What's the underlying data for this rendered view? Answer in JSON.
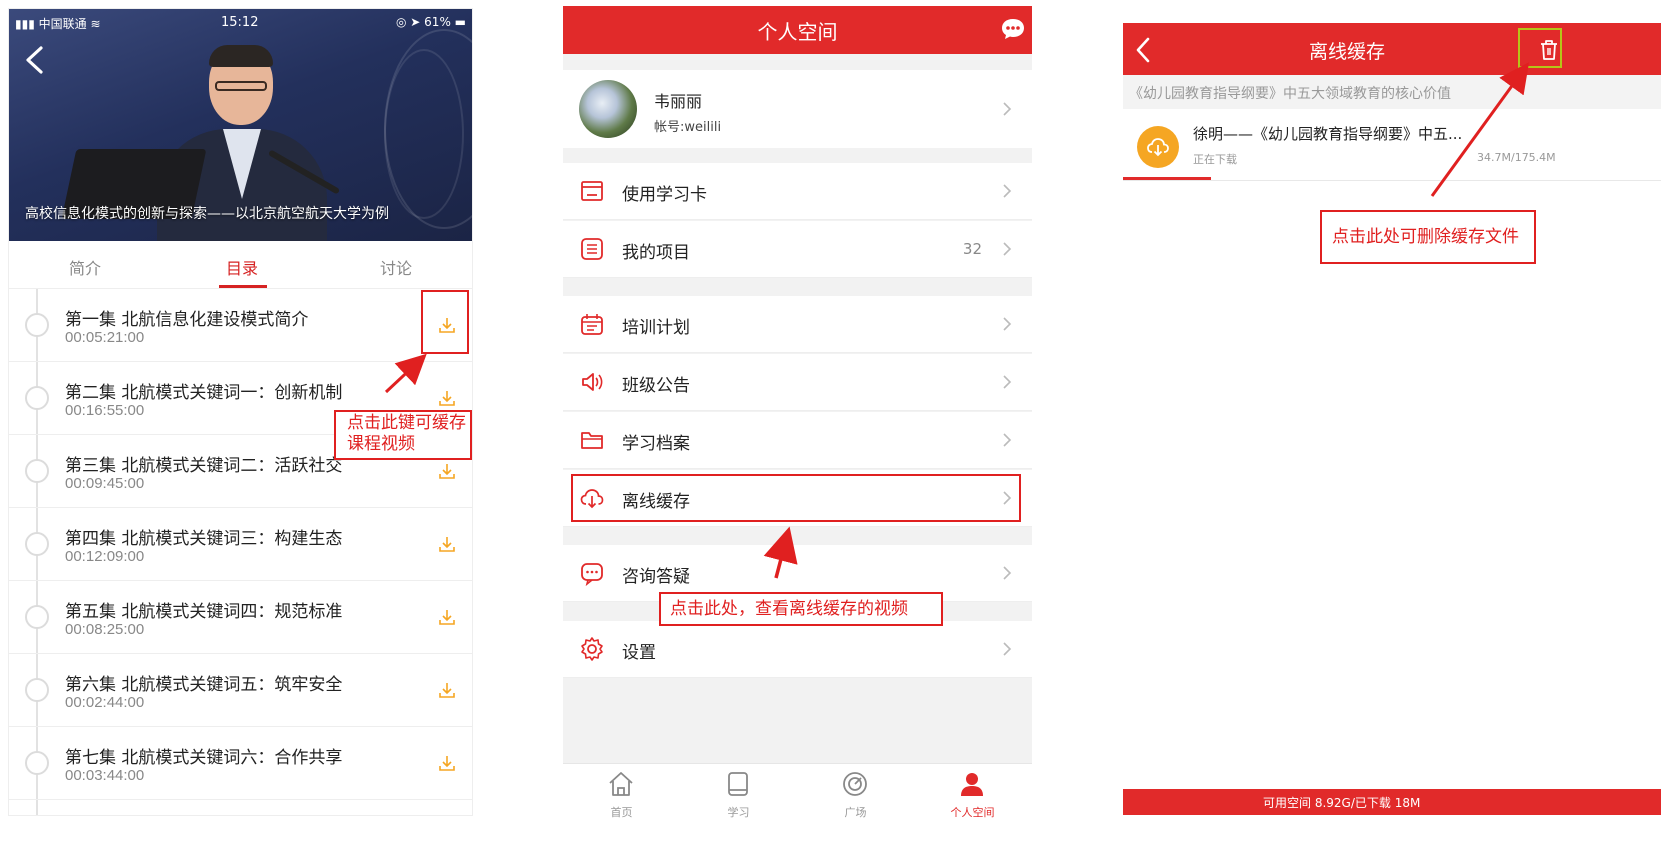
{
  "panel1": {
    "status": {
      "carrier": "中国联通",
      "time": "15:12",
      "battery": "61%"
    },
    "video_caption": "高校信息化模式的创新与探索——以北京航空航天大学为例",
    "tabs": [
      "简介",
      "目录",
      "讨论"
    ],
    "active_tab": "目录",
    "episodes": [
      {
        "title": "第一集 北航信息化建设模式简介",
        "duration": "00:05:21:00"
      },
      {
        "title": "第二集 北航模式关键词一：创新机制",
        "duration": "00:16:55:00"
      },
      {
        "title": "第三集 北航模式关键词二：活跃社交",
        "duration": "00:09:45:00"
      },
      {
        "title": "第四集 北航模式关键词三：构建生态",
        "duration": "00:12:09:00"
      },
      {
        "title": "第五集 北航模式关键词四：规范标准",
        "duration": "00:08:25:00"
      },
      {
        "title": "第六集 北航模式关键词五：筑牢安全",
        "duration": "00:02:44:00"
      },
      {
        "title": "第七集 北航模式关键词六：合作共享",
        "duration": "00:03:44:00"
      }
    ],
    "annotation": {
      "line1": "点击此键可缓存",
      "line2": "课程视频"
    }
  },
  "panel2": {
    "title": "个人空间",
    "user": {
      "name": "韦丽丽",
      "account": "帐号:weilili"
    },
    "menu": [
      {
        "label": "使用学习卡",
        "icon": "card-icon"
      },
      {
        "label": "我的项目",
        "icon": "list-icon",
        "count": "32"
      },
      {
        "label": "培训计划",
        "icon": "calendar-icon"
      },
      {
        "label": "班级公告",
        "icon": "speaker-icon"
      },
      {
        "label": "学习档案",
        "icon": "folder-icon"
      },
      {
        "label": "离线缓存",
        "icon": "cloud-download-icon"
      },
      {
        "label": "咨询答疑",
        "icon": "chat-bubble-icon"
      },
      {
        "label": "设置",
        "icon": "gear-icon"
      }
    ],
    "tabbar": [
      {
        "label": "首页",
        "icon": "home-icon"
      },
      {
        "label": "学习",
        "icon": "book-icon"
      },
      {
        "label": "广场",
        "icon": "target-icon"
      },
      {
        "label": "个人空间",
        "icon": "person-icon",
        "active": true
      }
    ],
    "annotation": "点击此处，查看离线缓存的视频"
  },
  "panel3": {
    "title": "离线缓存",
    "course_title": "《幼儿园教育指导纲要》中五大领域教育的核心价值",
    "download": {
      "name": "徐明——《幼儿园教育指导纲要》中五...",
      "status": "正在下载",
      "size": "34.7M/175.4M",
      "progress": 0.2
    },
    "footer": "可用空间 8.92G/已下载 18M",
    "annotation": "点击此处可删除缓存文件"
  },
  "colors": {
    "brand_red": "#e12a2a",
    "accent_orange": "#f5a623",
    "annotation_red": "#e02020"
  }
}
